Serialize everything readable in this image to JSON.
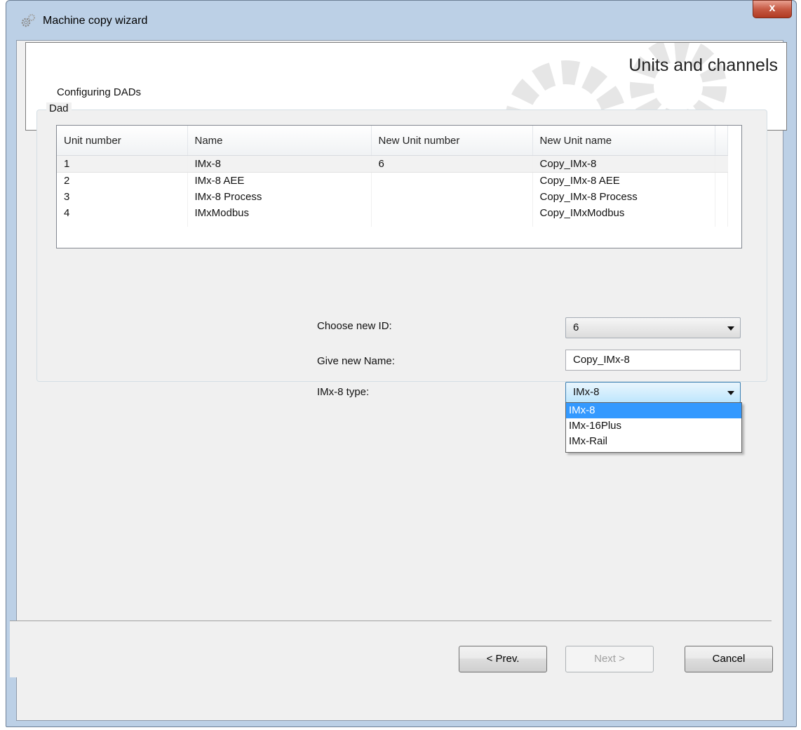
{
  "window": {
    "title": "Machine copy wizard",
    "close_label": "x"
  },
  "header": {
    "subtitle": "Configuring DADs",
    "title": "Units and channels"
  },
  "group": {
    "label": "Dad"
  },
  "grid": {
    "columns": [
      "Unit number",
      "Name",
      "New Unit number",
      "New Unit name"
    ],
    "rows": [
      [
        "1",
        "IMx-8",
        "6",
        "Copy_IMx-8"
      ],
      [
        "2",
        "IMx-8 AEE",
        "",
        "Copy_IMx-8 AEE"
      ],
      [
        "3",
        "IMx-8 Process",
        "",
        "Copy_IMx-8 Process"
      ],
      [
        "4",
        "IMxModbus",
        "",
        "Copy_IMxModbus"
      ]
    ]
  },
  "form": {
    "id_label": "Choose new ID:",
    "id_value": "6",
    "name_label": "Give new Name:",
    "name_value": "Copy_IMx-8",
    "type_label": "IMx-8 type:",
    "type_value": "IMx-8",
    "type_options": [
      "IMx-8",
      "IMx-16Plus",
      "IMx-Rail"
    ]
  },
  "footer": {
    "prev_label": "< Prev.",
    "next_label": "Next >",
    "cancel_label": "Cancel"
  }
}
